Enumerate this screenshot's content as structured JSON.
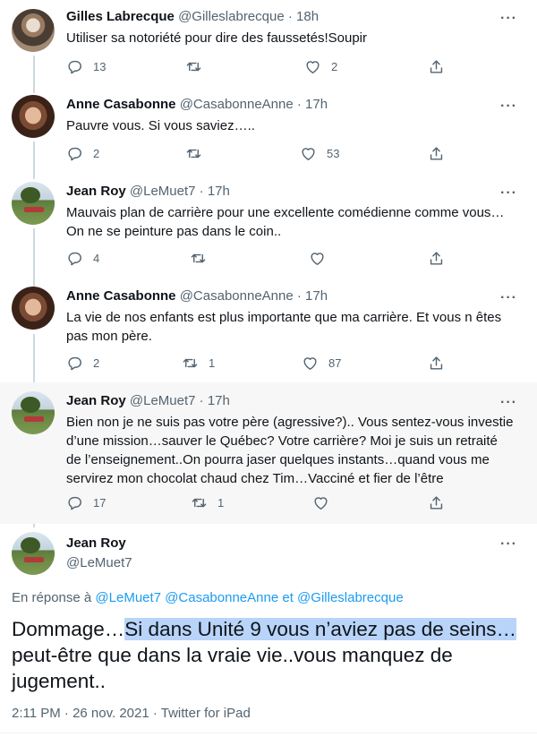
{
  "tweets": [
    {
      "name": "Gilles Labrecque",
      "handle": "@Gilleslabrecque",
      "time": "18h",
      "text": "Utiliser sa notoriété pour dire des faussetés!Soupir",
      "replies": "13",
      "retweets": "",
      "likes": "2"
    },
    {
      "name": "Anne Casabonne",
      "handle": "@CasabonneAnne",
      "time": "17h",
      "text": "Pauvre vous. Si vous saviez…..",
      "replies": "2",
      "retweets": "",
      "likes": "53"
    },
    {
      "name": "Jean Roy",
      "handle": "@LeMuet7",
      "time": "17h",
      "text": "Mauvais plan de carrière pour une excellente comédienne comme vous… On ne se peinture pas dans le coin..",
      "replies": "4",
      "retweets": "",
      "likes": ""
    },
    {
      "name": "Anne Casabonne",
      "handle": "@CasabonneAnne",
      "time": "17h",
      "text": "La vie de nos enfants est plus importante que ma carrière. Et vous n êtes pas mon père.",
      "replies": "2",
      "retweets": "1",
      "likes": "87"
    },
    {
      "name": "Jean Roy",
      "handle": "@LeMuet7",
      "time": "17h",
      "text": "Bien non je ne suis pas votre père (agressive?).. Vous sentez-vous investie d’une mission…sauver le Québec? Votre carrière? Moi je suis un retraité de l’enseignement..On pourra jaser quelques instants…quand vous me servirez mon chocolat chaud chez Tim…Vacciné et fier de l’être",
      "replies": "17",
      "retweets": "1",
      "likes": ""
    }
  ],
  "main": {
    "name": "Jean Roy",
    "handle": "@LeMuet7",
    "reply_prefix": "En réponse à",
    "reply_user1": "@LeMuet7",
    "reply_user2": "@CasabonneAnne",
    "reply_and": "et",
    "reply_user3": "@Gilleslabrecque",
    "text_before": "Dommage…",
    "text_selected": "Si dans Unité 9 vous n’aviez pas de seins…",
    "text_after": "peut-être que dans la vraie vie..vous manquez de jugement..",
    "timestamp": "2:11 PM · 26 nov. 2021 · Twitter for iPad"
  },
  "ui": {
    "dot": "·",
    "more": "···"
  },
  "colors": {
    "accent": "#1d9bf0",
    "muted": "#536471",
    "selection": "#b9d4f9",
    "highlight_bg": "#f7f7f7"
  },
  "icons": {
    "reply": "reply-icon",
    "retweet": "retweet-icon",
    "like": "heart-icon",
    "share": "share-icon",
    "more": "more-icon"
  }
}
